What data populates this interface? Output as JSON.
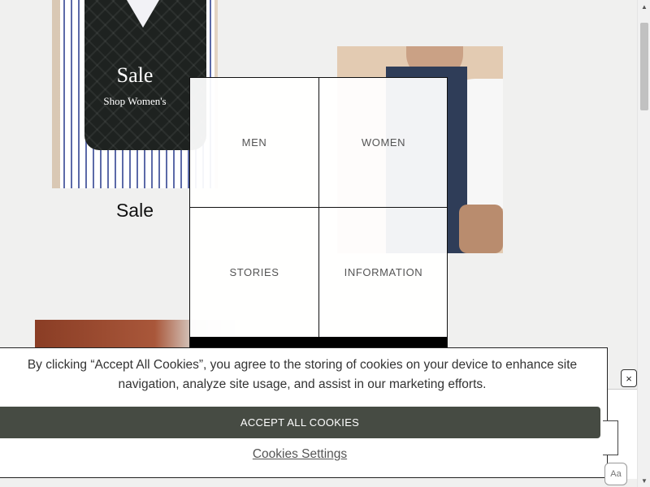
{
  "promos": {
    "sale": {
      "title": "Sale",
      "subtitle": "Shop Women's",
      "caption": "Sale"
    }
  },
  "menu": {
    "items": [
      {
        "label": "MEN"
      },
      {
        "label": "WOMEN"
      },
      {
        "label": "STORIES"
      },
      {
        "label": "INFORMATION"
      }
    ]
  },
  "cookie_banner": {
    "message": "By clicking “Accept All Cookies”, you agree to the storing of cookies on your device to enhance site navigation, analyze site usage, and assist in our marketing efforts.",
    "accept_label": "ACCEPT ALL COOKIES",
    "settings_label": "Cookies Settings",
    "close_icon": "×"
  },
  "widgets": {
    "text_size_label": "Aa"
  },
  "scrollbar": {
    "up_glyph": "▲",
    "down_glyph": "▼"
  },
  "colors": {
    "background": "#f0f0ef",
    "accept_button": "#464b43",
    "menu_border": "#111111"
  }
}
